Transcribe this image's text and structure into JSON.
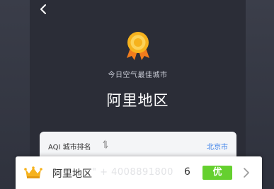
{
  "header": {
    "back_icon": "chevron-left-icon"
  },
  "hero": {
    "medal_icon": "gold-medal-icon",
    "subtitle": "今日空气最佳城市",
    "city_name": "阿里地区"
  },
  "ranking": {
    "label": "AQI 城市排名",
    "sort_icon": "sort-arrows-icon",
    "link": "北京市"
  },
  "row": {
    "crown_icon": "crown-icon",
    "city": "阿里地区",
    "watermark": "\" + 4008891800",
    "value": "6",
    "badge": "优",
    "badge_color": "#65d02f",
    "chevron_icon": "chevron-right-icon"
  },
  "colors": {
    "background": "#2b2e3a",
    "accent_blue": "#3f83ea",
    "medal_gold": "#f6b21d"
  }
}
